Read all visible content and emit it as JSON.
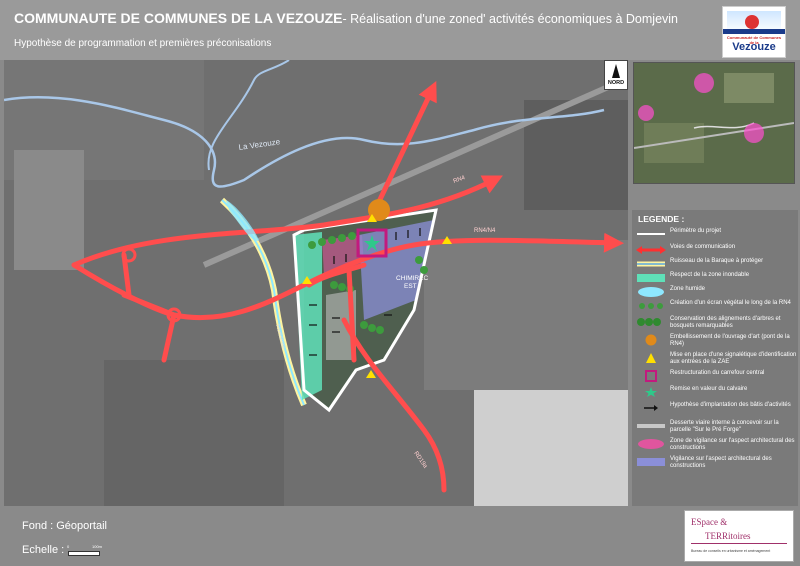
{
  "header": {
    "title": "COMMUNAUTE DE COMMUNES DE LA VEZOUZE",
    "title_suffix": "- Réalisation d'une zoned' activités économiques à Domjevin",
    "subtitle": "Hypothèse de programmation et premières préconisations"
  },
  "logo": {
    "small_text": "Communauté de Communes de la",
    "name": "Vezouze"
  },
  "map": {
    "labels": {
      "river": "La Vezouze",
      "stream": "Ruisseau",
      "zone_name_line1": "CHIMIREC",
      "zone_name_line2": "EST",
      "road_rn4_top": "RN4",
      "road_rn4_right": "RN4/N4",
      "road_rd": "RD19a"
    },
    "north_label": "NORD",
    "colors": {
      "road": "#ff4d4d",
      "perimeter": "#ffffff",
      "river": "#a9c7e8",
      "flood_zone": "#5fe0b8",
      "wet_zone": "#8ee8ff",
      "green_screen": "#3d9b3d",
      "vigilance": "#e0559e",
      "architectural": "#8b8fd8",
      "bridge": "#e08a1a",
      "sign": "#ffe000",
      "intersection": "#c21a7e",
      "calvary": "#2ec98a"
    }
  },
  "legend": {
    "title": "LEGENDE :",
    "items": [
      {
        "label": "Périmètre du projet",
        "icon": "white-line"
      },
      {
        "label": "Voies de communication",
        "icon": "red-double-arrow"
      },
      {
        "label": "Ruisseau de la Baraque à protéger",
        "icon": "yellow-blue-line"
      },
      {
        "label": "Respect de la zone inondable",
        "icon": "cyan-block"
      },
      {
        "label": "Zone humide",
        "icon": "light-blue-blob"
      },
      {
        "label": "Création d'un écran végétal le long de la RN4",
        "icon": "green-dots"
      },
      {
        "label": "Conservation des alignements d'arbres et bosquets remarquables",
        "icon": "green-trees"
      },
      {
        "label": "Embellissement de l'ouvrage d'art (pont de la RN4)",
        "icon": "orange-circle"
      },
      {
        "label": "Mise en place d'une signalétique d'identification aux entrées de la ZAE",
        "icon": "yellow-triangle"
      },
      {
        "label": "Restructuration du carrefour central",
        "icon": "magenta-square"
      },
      {
        "label": "Remise en valeur du calvaire",
        "icon": "green-star"
      },
      {
        "label": "Hypothèse d'implantation des bâtis d'activités",
        "icon": "black-arrow"
      },
      {
        "label": "Desserte viaire interne à concevoir sur la parcelle \"Sur le Pré Forge\"",
        "icon": "grey-bar"
      },
      {
        "label": "Zone de vigilance sur l'aspect architectural des constructions",
        "icon": "pink-blob"
      },
      {
        "label": "Vigilance sur l'aspect architectural des constructions",
        "icon": "blue-block"
      }
    ]
  },
  "footer": {
    "fond": "Fond : Géoportail",
    "echelle": "Echelle :",
    "scale_min": "0",
    "scale_max": "100m"
  },
  "logo2": {
    "line1": "ESpace &",
    "line2": "TERRitoires",
    "tagline": "Bureau de conseils en urbanisme et aménagement"
  }
}
